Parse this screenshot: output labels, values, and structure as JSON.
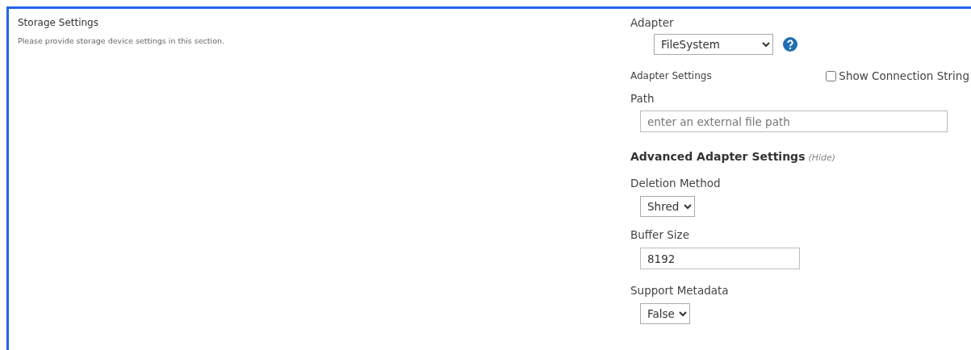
{
  "section": {
    "title": "Storage Settings",
    "description": "Please provide storage device settings in this section."
  },
  "adapter": {
    "label": "Adapter",
    "value": "FileSystem"
  },
  "adapter_settings": {
    "label": "Adapter Settings",
    "show_connection_string": {
      "label": "Show Connection String",
      "checked": false
    }
  },
  "path": {
    "label": "Path",
    "placeholder": "enter an external file path"
  },
  "advanced": {
    "title": "Advanced Adapter Settings",
    "toggle": "(Hide)"
  },
  "fields": [
    {
      "kind": "select",
      "label": "Deletion Method",
      "value": "Shred"
    },
    {
      "kind": "text",
      "label": "Buffer Size",
      "value": "8192"
    },
    {
      "kind": "select",
      "label": "Support Metadata",
      "value": "False"
    }
  ]
}
